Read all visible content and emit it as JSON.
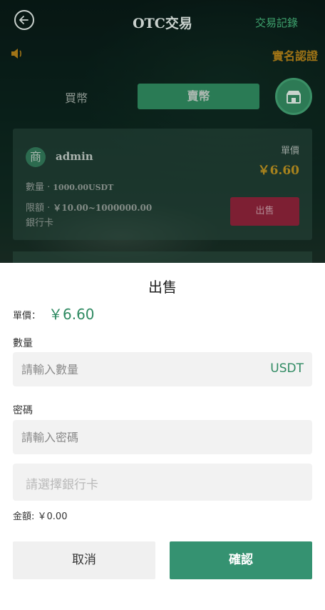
{
  "background": {
    "title": "OTC交易",
    "trade_log_link": "交易記錄",
    "realname_link": "實名認證",
    "tabs": {
      "buy": "買幣",
      "sell": "賣幣"
    },
    "order": {
      "avatar_char": "商",
      "merchant": "admin",
      "price_label": "單價",
      "price": "￥6.60",
      "qty_label": "數量 ·",
      "qty_value": "1000.00USDT",
      "limit_label": "限額 ·",
      "limit_value": "￥10.00~1000000.00",
      "bank_label": "銀行卡",
      "sell_button": "出售"
    }
  },
  "sheet": {
    "title": "出售",
    "unit_price_label": "單價：",
    "unit_price_value": "￥6.60",
    "qty_label": "數量",
    "qty_placeholder": "請輸入數量",
    "qty_unit": "USDT",
    "pwd_label": "密碼",
    "pwd_placeholder": "請輸入密碼",
    "bank_placeholder": "請選擇銀行卡",
    "amount_label": "金額:",
    "amount_value": "￥0.00",
    "cancel": "取消",
    "confirm": "確認"
  },
  "colors": {
    "accent": "#359271",
    "price_green": "#2f8a62",
    "sell_red": "#7d1f33",
    "gold": "#a7821d"
  }
}
